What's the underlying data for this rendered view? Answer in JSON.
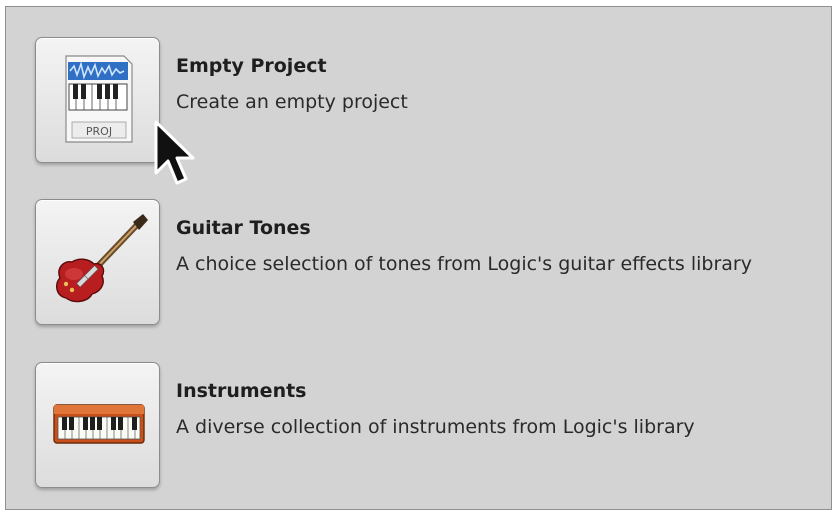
{
  "templates": [
    {
      "title": "Empty Project",
      "description": "Create an empty project",
      "icon": "empty-project-icon",
      "icon_label": "PROJ"
    },
    {
      "title": "Guitar Tones",
      "description": "A choice selection of tones from Logic's guitar effects library",
      "icon": "electric-guitar-icon"
    },
    {
      "title": "Instruments",
      "description": "A diverse collection of instruments from Logic's library",
      "icon": "keyboard-instrument-icon"
    }
  ],
  "cursor": "arrow-cursor-icon",
  "colors": {
    "panel_background": "#d3d3d3",
    "guitar_body": "#b81d20",
    "keyboard_body": "#c8501a",
    "project_icon_accent": "#2f6fc4"
  }
}
